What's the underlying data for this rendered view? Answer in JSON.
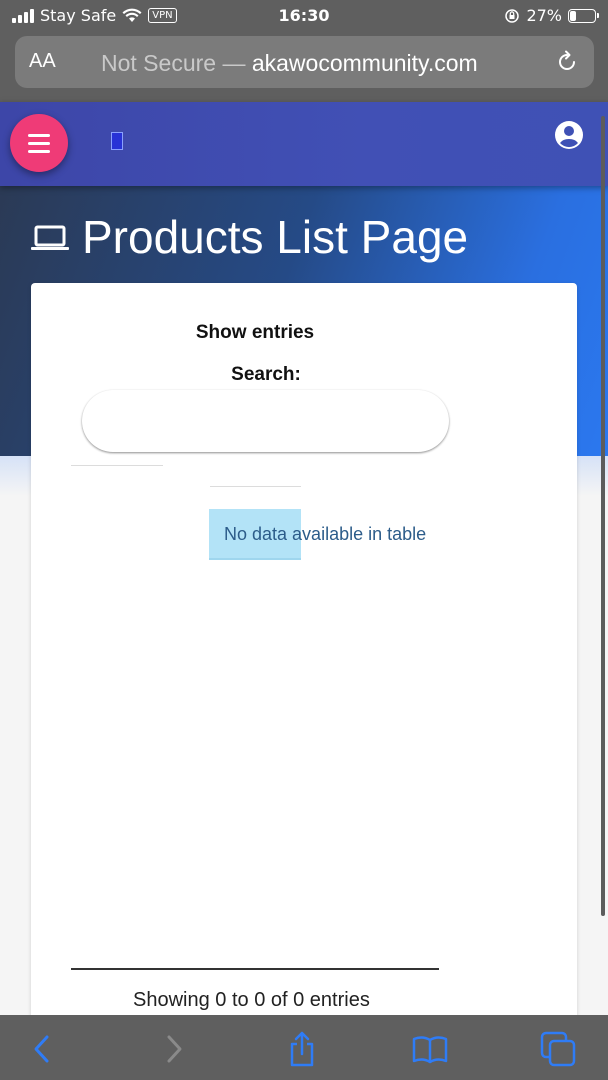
{
  "status_bar": {
    "carrier": "Stay Safe",
    "vpn": "VPN",
    "time": "16:30",
    "battery": "27%",
    "battery_level": 0.27
  },
  "browser": {
    "aa_label": "AA",
    "security": "Not Secure",
    "separator": " — ",
    "domain": "akawocommunity.com"
  },
  "app": {
    "page_title": "Products List Page",
    "accent_color": "#ef3b77",
    "bar_color": "#3f51b5"
  },
  "table": {
    "show_entries": "Show entries",
    "search_label": "Search:",
    "search_value": "",
    "empty_message": "No data available in table",
    "info": "Showing 0 to 0 of 0 entries"
  },
  "icons": {
    "menu": "hamburger-icon",
    "account": "account-circle-icon",
    "title": "laptop-icon",
    "reload": "reload-icon",
    "back": "chevron-left-icon",
    "forward": "chevron-right-icon",
    "share": "share-icon",
    "bookmarks": "book-icon",
    "tabs": "tabs-icon"
  }
}
